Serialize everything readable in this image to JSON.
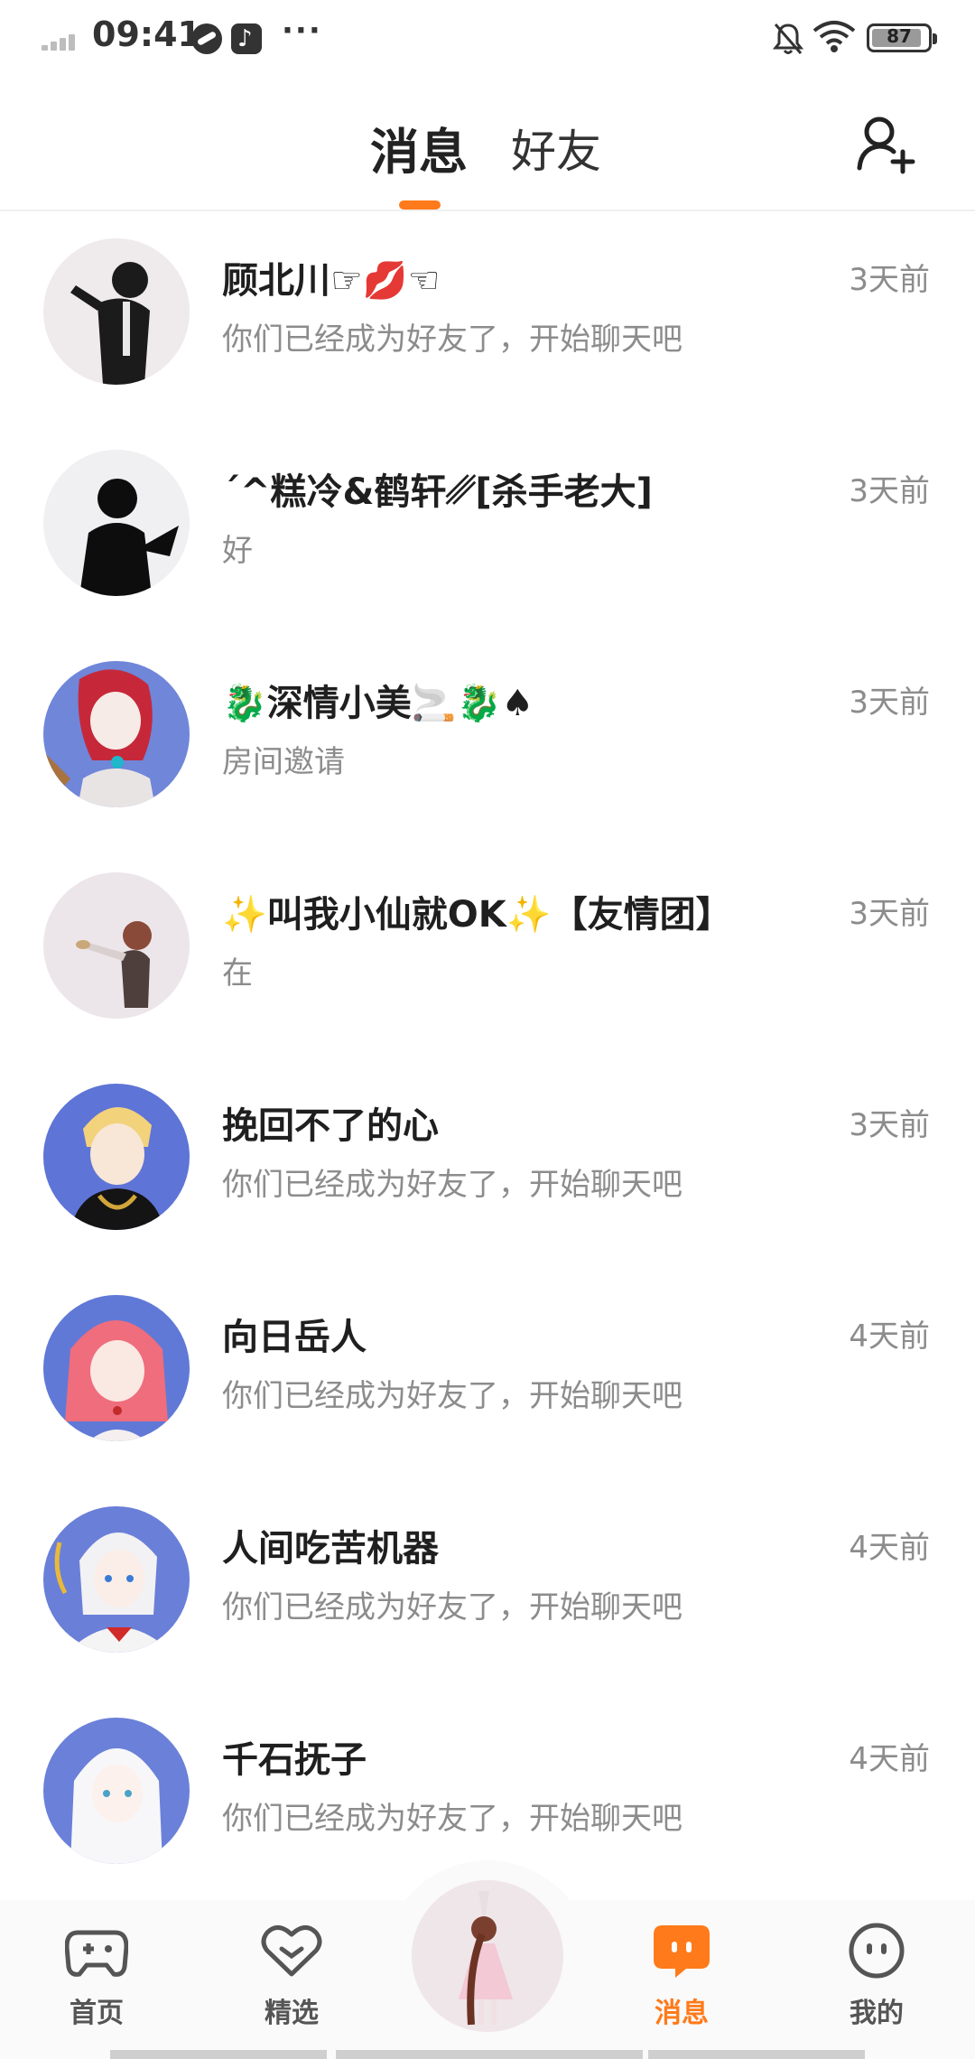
{
  "status_bar": {
    "time": "09:41",
    "dots": "···",
    "battery": "87"
  },
  "header": {
    "tabs": [
      {
        "label": "消息",
        "active": true
      },
      {
        "label": "好友",
        "active": false
      }
    ],
    "add_friend_icon": "add-user-icon",
    "accent_color": "#ff7a1a"
  },
  "messages": [
    {
      "name": "顾北川☞💋☜",
      "preview": "你们已经成为好友了，开始聊天吧",
      "time": "3天前"
    },
    {
      "name": "´^糕冷&鹤轩␥[杀手老大]",
      "preview": "好",
      "time": "3天前"
    },
    {
      "name": "🐉深情小美🚬🐉♠",
      "preview": "房间邀请",
      "time": "3天前"
    },
    {
      "name": "✨叫我小仙就OK✨【友情团】",
      "preview": "在",
      "time": "3天前"
    },
    {
      "name": "挽回不了的心",
      "preview": "你们已经成为好友了，开始聊天吧",
      "time": "3天前"
    },
    {
      "name": "向日岳人",
      "preview": "你们已经成为好友了，开始聊天吧",
      "time": "4天前"
    },
    {
      "name": "人间吃苦机器",
      "preview": "你们已经成为好友了，开始聊天吧",
      "time": "4天前"
    },
    {
      "name": "千石抚子",
      "preview": "你们已经成为好友了，开始聊天吧",
      "time": "4天前"
    }
  ],
  "bottom_nav": {
    "items": [
      {
        "label": "首页",
        "icon": "gamepad-icon"
      },
      {
        "label": "精选",
        "icon": "heart-icon"
      },
      {
        "label": "消息",
        "icon": "chat-icon",
        "active": true
      },
      {
        "label": "我的",
        "icon": "face-icon"
      }
    ]
  }
}
